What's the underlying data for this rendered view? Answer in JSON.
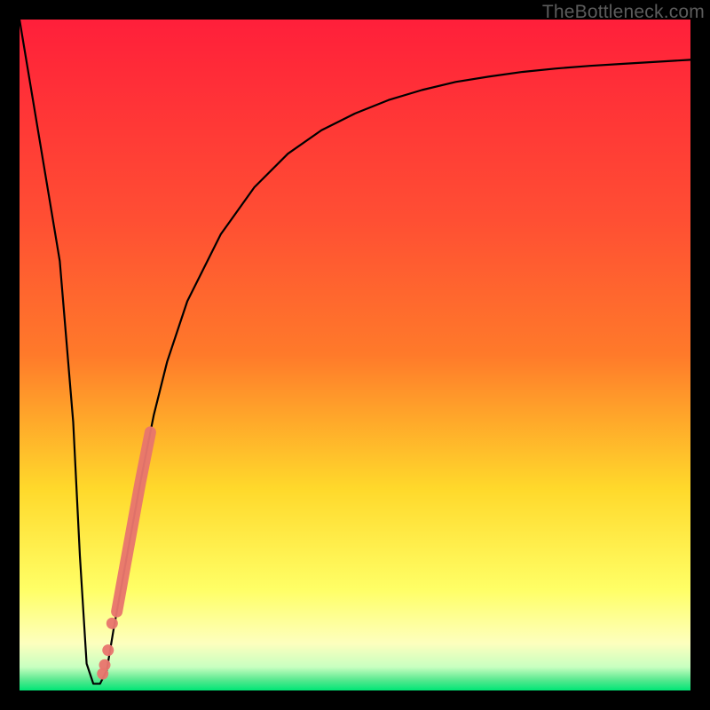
{
  "watermark": "TheBottleneck.com",
  "colors": {
    "frame": "#000000",
    "gradient_top": "#ff1f3a",
    "gradient_mid1": "#ff7a2a",
    "gradient_mid2": "#ffd92b",
    "gradient_mid3": "#ffff66",
    "gradient_mid4": "#fdffbe",
    "gradient_bottom": "#00e676",
    "curve": "#000000",
    "marker": "#e8766d"
  },
  "chart_data": {
    "type": "line",
    "title": "",
    "xlabel": "",
    "ylabel": "",
    "xlim": [
      0,
      100
    ],
    "ylim": [
      0,
      100
    ],
    "grid": false,
    "legend": false,
    "series": [
      {
        "name": "bottleneck_curve",
        "x": [
          0,
          2,
          4,
          6,
          8,
          9,
          10,
          11,
          12,
          13,
          14,
          16,
          18,
          20,
          22,
          25,
          30,
          35,
          40,
          45,
          50,
          55,
          60,
          65,
          70,
          75,
          80,
          85,
          90,
          95,
          100
        ],
        "y": [
          100,
          88,
          76,
          64,
          40,
          20,
          4,
          1,
          1,
          3,
          9,
          20,
          31,
          41,
          49,
          58,
          68,
          75,
          80,
          83.5,
          86,
          88,
          89.5,
          90.7,
          91.5,
          92.2,
          92.7,
          93.1,
          93.4,
          93.7,
          94
        ]
      }
    ],
    "markers": [
      {
        "name": "highlight_band",
        "comment": "thick salmon segment along curve",
        "x_range": [
          14.5,
          19.5
        ],
        "y_range": [
          15,
          38
        ]
      },
      {
        "name": "dot_a",
        "x": 13.8,
        "y": 10
      },
      {
        "name": "dot_b",
        "x": 13.2,
        "y": 6
      },
      {
        "name": "dot_c",
        "x": 12.4,
        "y": 2.5
      },
      {
        "name": "dot_d",
        "x": 12.7,
        "y": 3.8
      }
    ]
  }
}
